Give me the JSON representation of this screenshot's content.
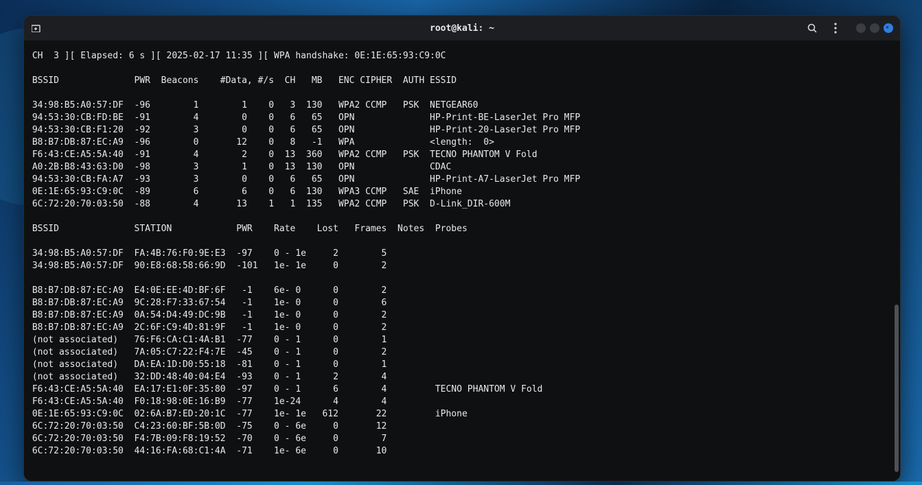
{
  "titlebar": {
    "title": "root@kali: ~"
  },
  "status_line": " CH  3 ][ Elapsed: 6 s ][ 2025-02-17 11:35 ][ WPA handshake: 0E:1E:65:93:C9:0C",
  "ap_header": " BSSID              PWR  Beacons    #Data, #/s  CH   MB   ENC CIPHER  AUTH ESSID",
  "ap_rows": [
    " 34:98:B5:A0:57:DF  -96        1        1    0   3  130   WPA2 CCMP   PSK  NETGEAR60",
    " 94:53:30:CB:FD:BE  -91        4        0    0   6   65   OPN              HP-Print-BE-LaserJet Pro MFP",
    " 94:53:30:CB:F1:20  -92        3        0    0   6   65   OPN              HP-Print-20-LaserJet Pro MFP",
    " B8:B7:DB:87:EC:A9  -96        0       12    0   8   -1   WPA              <length:  0>",
    " F6:43:CE:A5:5A:40  -91        4        2    0  13  360   WPA2 CCMP   PSK  TECNO PHANTOM V Fold",
    " A0:2B:B8:43:63:D0  -98        3        1    0  13  130   OPN              CDAC",
    " 94:53:30:CB:FA:A7  -93        3        0    0   6   65   OPN              HP-Print-A7-LaserJet Pro MFP",
    " 0E:1E:65:93:C9:0C  -89        6        6    0   6  130   WPA3 CCMP   SAE  iPhone",
    " 6C:72:20:70:03:50  -88        4       13    1   1  135   WPA2 CCMP   PSK  D-Link_DIR-600M"
  ],
  "sta_header": " BSSID              STATION            PWR    Rate    Lost   Frames  Notes  Probes",
  "sta_rows_a": [
    " 34:98:B5:A0:57:DF  FA:4B:76:F0:9E:E3  -97    0 - 1e     2        5",
    " 34:98:B5:A0:57:DF  90:E8:68:58:66:9D  -101   1e- 1e     0        2"
  ],
  "sta_rows_b": [
    " B8:B7:DB:87:EC:A9  E4:0E:EE:4D:BF:6F   -1    6e- 0      0        2",
    " B8:B7:DB:87:EC:A9  9C:28:F7:33:67:54   -1    1e- 0      0        6",
    " B8:B7:DB:87:EC:A9  0A:54:D4:49:DC:9B   -1    1e- 0      0        2",
    " B8:B7:DB:87:EC:A9  2C:6F:C9:4D:81:9F   -1    1e- 0      0        2",
    " (not associated)   76:F6:CA:C1:4A:B1  -77    0 - 1      0        1",
    " (not associated)   7A:05:C7:22:F4:7E  -45    0 - 1      0        2",
    " (not associated)   DA:EA:1D:D0:55:18  -81    0 - 1      0        1",
    " (not associated)   32:DD:48:40:04:E4  -93    0 - 1      2        4",
    " F6:43:CE:A5:5A:40  EA:17:E1:0F:35:80  -97    0 - 1      6        4         TECNO PHANTOM V Fold",
    " F6:43:CE:A5:5A:40  F0:18:98:0E:16:B9  -77    1e-24      4        4",
    " 0E:1E:65:93:C9:0C  02:6A:B7:ED:20:1C  -77    1e- 1e   612       22         iPhone",
    " 6C:72:20:70:03:50  C4:23:60:BF:5B:0D  -75    0 - 6e     0       12",
    " 6C:72:20:70:03:50  F4:7B:09:F8:19:52  -70    0 - 6e     0        7",
    " 6C:72:20:70:03:50  44:16:FA:68:C1:4A  -71    1e- 6e     0       10"
  ],
  "scrollbar": {
    "thumb_top_pct": 60,
    "thumb_height_pct": 38
  }
}
